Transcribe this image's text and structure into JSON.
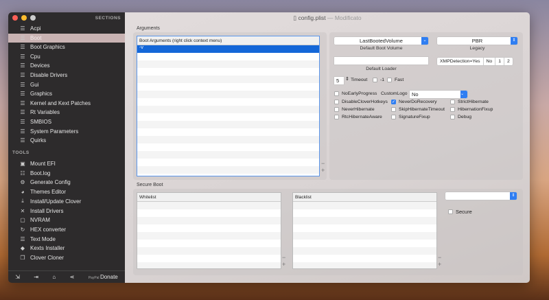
{
  "window": {
    "filename": "config.plist",
    "status": "— Modificato"
  },
  "sidebar": {
    "sections_label": "SECTIONS",
    "sections": [
      {
        "label": "Acpi",
        "icon": "list-icon"
      },
      {
        "label": "Boot",
        "icon": "list-icon",
        "selected": true
      },
      {
        "label": "Boot Graphics",
        "icon": "list-icon"
      },
      {
        "label": "Cpu",
        "icon": "list-icon"
      },
      {
        "label": "Devices",
        "icon": "list-icon"
      },
      {
        "label": "Disable Drivers",
        "icon": "list-icon"
      },
      {
        "label": "Gui",
        "icon": "list-icon"
      },
      {
        "label": "Graphics",
        "icon": "list-icon"
      },
      {
        "label": "Kernel and Kext Patches",
        "icon": "list-icon"
      },
      {
        "label": "Rt Variables",
        "icon": "list-icon"
      },
      {
        "label": "SMBIOS",
        "icon": "list-icon"
      },
      {
        "label": "System Parameters",
        "icon": "list-icon"
      },
      {
        "label": "Quirks",
        "icon": "list-icon"
      }
    ],
    "tools_label": "TOOLS",
    "tools": [
      {
        "label": "Mount EFI",
        "icon": "disk-icon",
        "glyph": "▣"
      },
      {
        "label": "Boot.log",
        "icon": "log-icon",
        "glyph": "☷"
      },
      {
        "label": "Generate Config",
        "icon": "gears-icon",
        "glyph": "⚙"
      },
      {
        "label": "Themes Editor",
        "icon": "palette-icon",
        "glyph": "◕"
      },
      {
        "label": "Install/Update Clover",
        "icon": "download-icon",
        "glyph": "⤓"
      },
      {
        "label": "Install Drivers",
        "icon": "tools-icon",
        "glyph": "✕"
      },
      {
        "label": "NVRAM",
        "icon": "chip-icon",
        "glyph": "▢"
      },
      {
        "label": "HEX converter",
        "icon": "refresh-icon",
        "glyph": "↻"
      },
      {
        "label": "Text Mode",
        "icon": "text-icon",
        "glyph": "☰"
      },
      {
        "label": "Kexts Installer",
        "icon": "kext-icon",
        "glyph": "◆"
      },
      {
        "label": "Clover Cloner",
        "icon": "clone-icon",
        "glyph": "❐"
      }
    ],
    "donate_label": "Donate"
  },
  "arguments": {
    "label": "Arguments",
    "header": "Boot Arguments (right click context menu)",
    "rows": [
      "-v"
    ]
  },
  "boot": {
    "default_volume": "LastBootedVolume",
    "default_volume_caption": "Default Boot Volume",
    "legacy": "PBR",
    "legacy_caption": "Legacy",
    "default_loader": "",
    "default_loader_caption": "Default Loader",
    "xmp": [
      "XMPDetection=Yes",
      "No",
      "1",
      "2"
    ],
    "timeout": "5",
    "timeout_label": "Timeout",
    "minus1_label": "-1",
    "fast_label": "Fast",
    "no_early_progress": "NoEarlyProgress",
    "custom_logo_label": "CustomLogo",
    "custom_logo": "No",
    "checks": [
      {
        "label": "DisableCloverHotkeys",
        "on": false
      },
      {
        "label": "NeverDoRecovery",
        "on": true
      },
      {
        "label": "StrictHibernate",
        "on": false
      },
      {
        "label": "NeverHibernate",
        "on": false
      },
      {
        "label": "SkipHibernateTimeout",
        "on": false
      },
      {
        "label": "HibernationFixup",
        "on": false
      },
      {
        "label": "RtcHibernateAware",
        "on": false
      },
      {
        "label": "SignatureFixup",
        "on": false
      },
      {
        "label": "Debug",
        "on": false
      }
    ]
  },
  "secure_boot": {
    "label": "Secure Boot",
    "whitelist": "Whitelist",
    "blacklist": "Blacklist",
    "policy": "",
    "secure_label": "Secure"
  }
}
